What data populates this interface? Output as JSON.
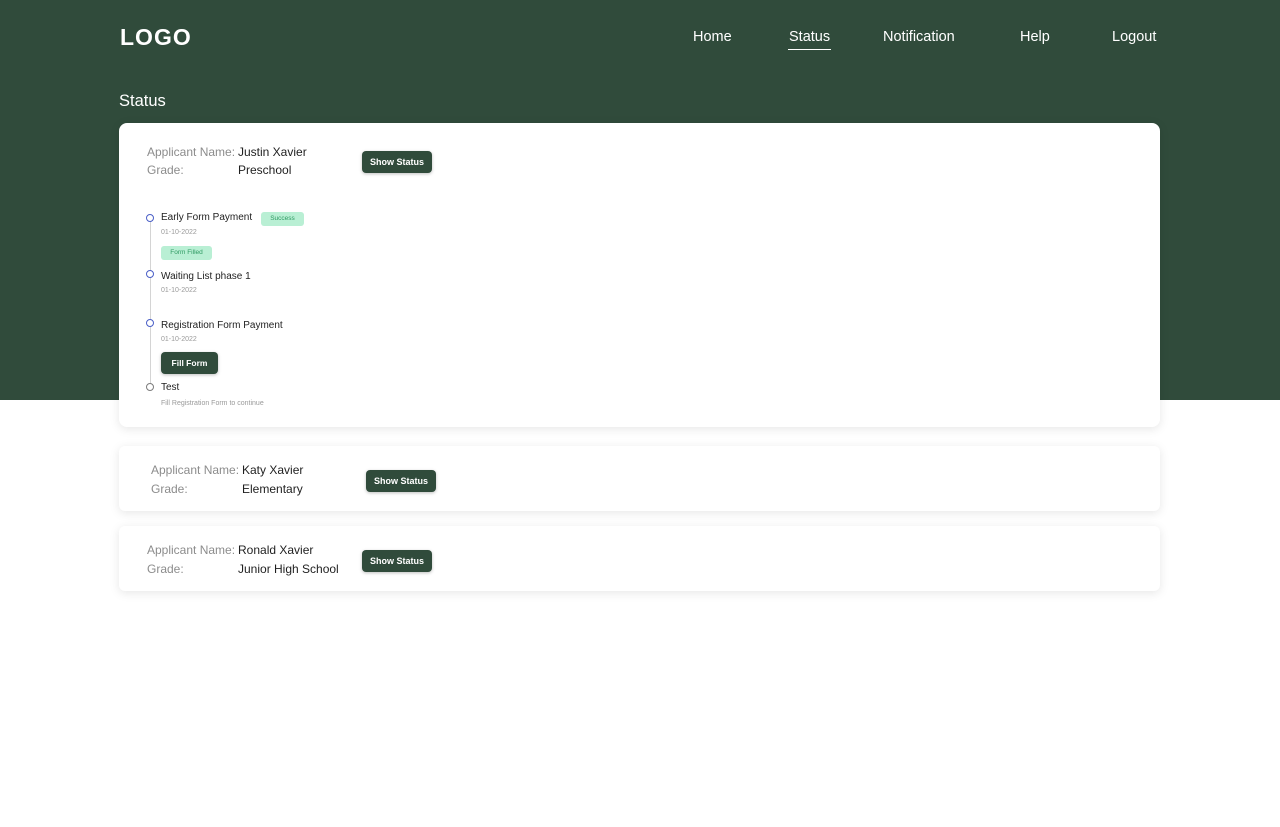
{
  "header": {
    "logo": "LOGO",
    "nav": [
      {
        "label": "Home",
        "active": false
      },
      {
        "label": "Status",
        "active": true
      },
      {
        "label": "Notification",
        "active": false
      },
      {
        "label": "Help",
        "active": false
      },
      {
        "label": "Logout",
        "active": false
      }
    ]
  },
  "page": {
    "title": "Status"
  },
  "labels": {
    "applicant_name": "Applicant Name:",
    "grade": "Grade:",
    "show_status": "Show Status"
  },
  "applicants": [
    {
      "name": "Justin Xavier",
      "grade": "Preschool",
      "expanded": true,
      "timeline": [
        {
          "title": "Early Form Payment",
          "badge": "Success",
          "date": "01-10-2022",
          "state": "done"
        },
        {
          "title": "Waiting List phase 1",
          "badge_above": "Form Filled",
          "date": "01-10-2022",
          "state": "done"
        },
        {
          "title": "Registration Form Payment",
          "date": "01-10-2022",
          "action": "Fill Form",
          "state": "done"
        },
        {
          "title": "Test",
          "note": "Fill Registration Form to continue",
          "state": "pending"
        }
      ]
    },
    {
      "name": "Katy Xavier",
      "grade": "Elementary",
      "expanded": false
    },
    {
      "name": "Ronald Xavier",
      "grade": "Junior High School",
      "expanded": false
    }
  ],
  "colors": {
    "brand_green": "#304b3b",
    "timeline_dot": "#4a5fc7",
    "badge_bg": "#b9efd4",
    "badge_text": "#2e9a62"
  }
}
